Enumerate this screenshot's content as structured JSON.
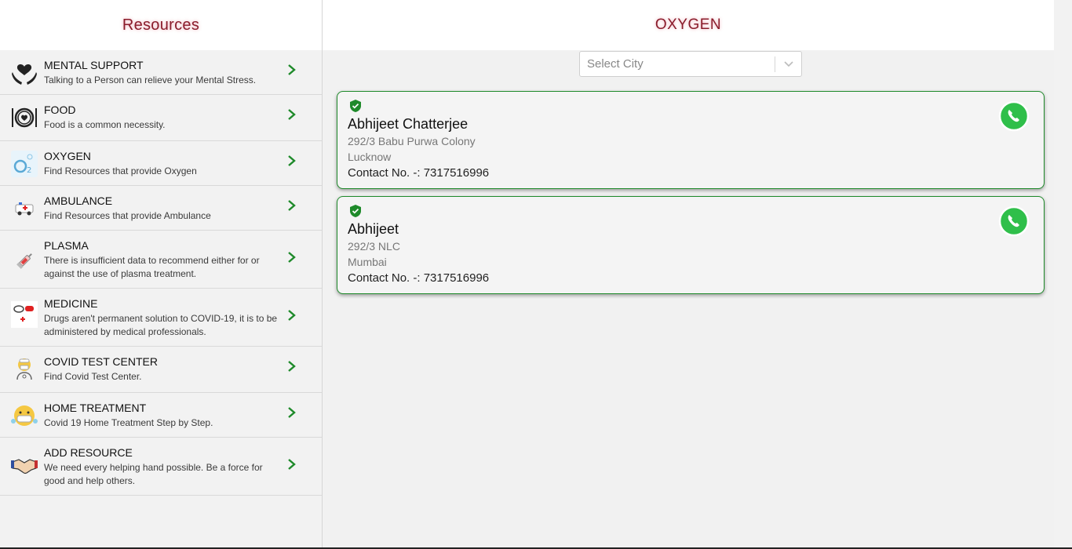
{
  "sidebar": {
    "title": "Resources",
    "items": [
      {
        "title": "MENTAL SUPPORT",
        "desc": "Talking to a Person can relieve your Mental Stress.",
        "icon": "hands-heart-icon"
      },
      {
        "title": "FOOD",
        "desc": "Food is a common necessity.",
        "icon": "plate-heart-icon"
      },
      {
        "title": "OXYGEN",
        "desc": "Find Resources that provide Oxygen",
        "icon": "oxygen-icon"
      },
      {
        "title": "AMBULANCE",
        "desc": "Find Resources that provide Ambulance",
        "icon": "ambulance-icon"
      },
      {
        "title": "PLASMA",
        "desc": "There is insufficient data to recommend either for or against the use of plasma treatment.",
        "icon": "syringe-icon"
      },
      {
        "title": "MEDICINE",
        "desc": "Drugs aren't permanent solution to COVID-19, it is to be administered by medical professionals.",
        "icon": "medicine-icon"
      },
      {
        "title": "COVID TEST CENTER",
        "desc": "Find Covid Test Center.",
        "icon": "doctor-icon"
      },
      {
        "title": "HOME TREATMENT",
        "desc": "Covid 19 Home Treatment Step by Step.",
        "icon": "mask-face-icon"
      },
      {
        "title": "ADD RESOURCE",
        "desc": "We need every helping hand possible. Be a force for good and help others.",
        "icon": "handshake-icon"
      }
    ]
  },
  "main": {
    "title": "OXYGEN",
    "city_select": {
      "placeholder": "Select City"
    },
    "cards": [
      {
        "name": "Abhijeet Chatterjee",
        "address": "292/3 Babu Purwa Colony",
        "city": "Lucknow",
        "contact": "Contact No. -: 7317516996"
      },
      {
        "name": "Abhijeet",
        "address": "292/3 NLC",
        "city": "Mumbai",
        "contact": "Contact No. -: 7317516996"
      }
    ]
  },
  "colors": {
    "accent_green": "#1e8a2a",
    "header_text": "#8a1c2b",
    "whatsapp_green": "#2fbf4a"
  }
}
